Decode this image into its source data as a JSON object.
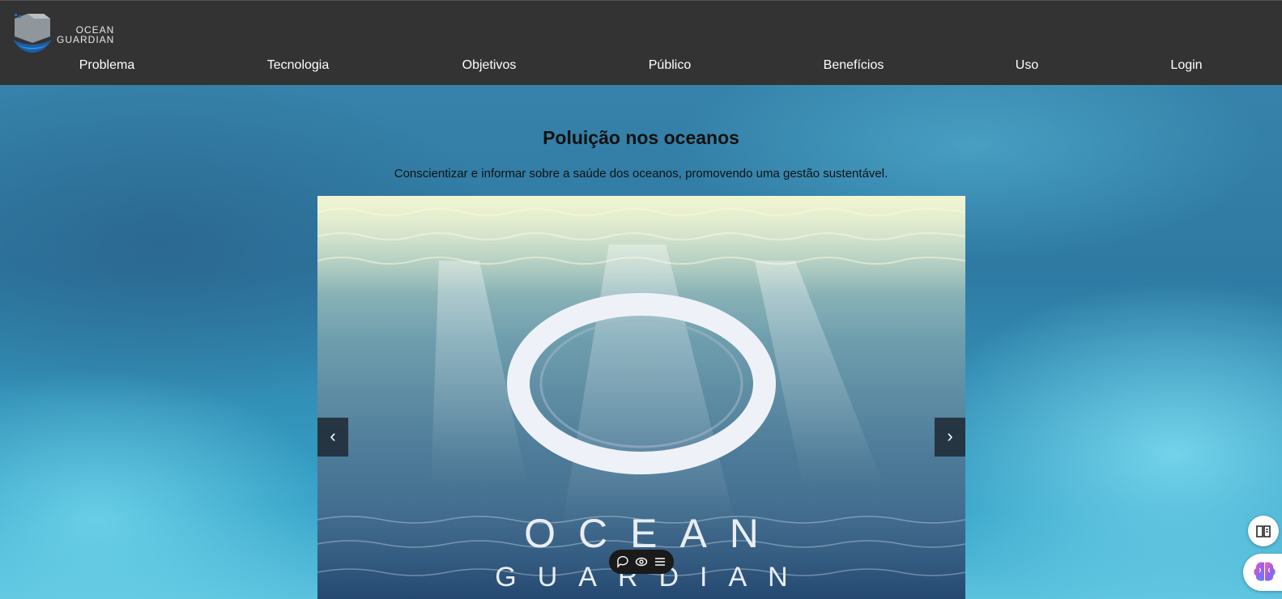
{
  "brand": {
    "line1": "OCEAN",
    "line2": "GUARDIAN"
  },
  "nav": {
    "items": [
      {
        "label": "Problema"
      },
      {
        "label": "Tecnologia"
      },
      {
        "label": "Objetivos"
      },
      {
        "label": "Público"
      },
      {
        "label": "Benefícios"
      },
      {
        "label": "Uso"
      },
      {
        "label": "Login"
      }
    ]
  },
  "hero": {
    "title": "Poluição nos oceanos",
    "subtitle": "Conscientizar e informar sobre a saúde dos oceanos, promovendo uma gestão sustentável."
  },
  "carousel": {
    "slide_word1": "OCEAN",
    "slide_word2": "GUARDIAN",
    "prev": "‹",
    "next": "›"
  },
  "colors": {
    "header_bg": "#333333",
    "text_dark": "#111111"
  },
  "icons": [
    "chat-icon",
    "eye-icon",
    "menu-icon",
    "reader-icon",
    "brain-icon"
  ]
}
